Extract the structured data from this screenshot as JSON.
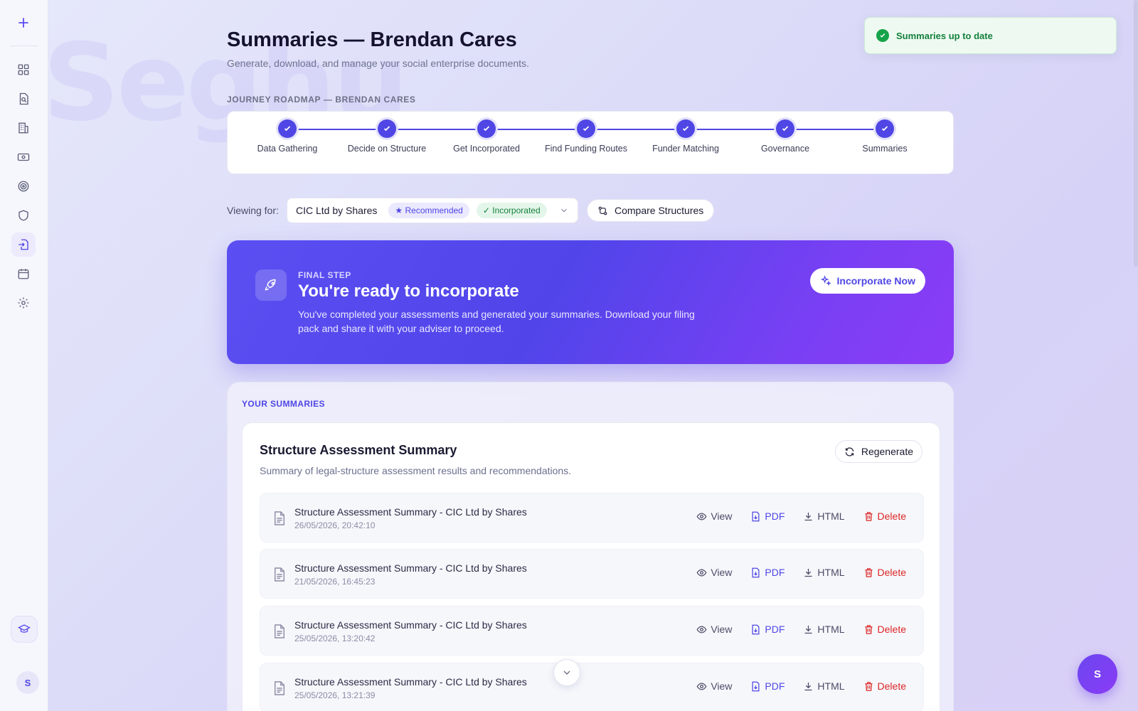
{
  "page": {
    "title": "Summaries — Brendan Cares",
    "subtitle": "Generate, download, and manage your social enterprise documents.",
    "watermark": "Seghu"
  },
  "sidebar": {
    "icons": [
      "plus-icon",
      "dashboard-icon",
      "search-document-icon",
      "building-icon",
      "money-icon",
      "target-icon",
      "shield-icon",
      "file-export-icon",
      "calendar-icon",
      "gear-icon",
      "graduation-cap-icon"
    ],
    "active": "file-export-icon",
    "avatar_initial": "S"
  },
  "roadmap": {
    "label": "JOURNEY ROADMAP — BRENDAN CARES",
    "steps": [
      {
        "label": "Data Gathering",
        "status": "complete"
      },
      {
        "label": "Decide on Structure",
        "status": "complete"
      },
      {
        "label": "Get Incorporated",
        "status": "complete"
      },
      {
        "label": "Find Funding Routes",
        "status": "complete"
      },
      {
        "label": "Funder Matching",
        "status": "complete"
      },
      {
        "label": "Governance",
        "status": "complete"
      },
      {
        "label": "Summaries",
        "status": "complete"
      }
    ]
  },
  "viewing": {
    "label": "Viewing for:",
    "structure": "CIC Ltd by Shares",
    "badge_recommended": "★ Recommended",
    "badge_incorporated": "✓ Incorporated",
    "compare_label": "Compare Structures"
  },
  "hero": {
    "eyebrow": "FINAL STEP",
    "title": "You're ready to incorporate",
    "text": "You've completed your assessments and generated your summaries. Download your filing pack and share it with your adviser to proceed.",
    "button": "Incorporate Now"
  },
  "summaries": {
    "label": "YOUR SUMMARIES",
    "card_title": "Structure Assessment Summary",
    "card_desc": "Summary of legal-structure assessment results and recommendations.",
    "regenerate": "Regenerate",
    "actions": {
      "view": "View",
      "pdf": "PDF",
      "html": "HTML",
      "delete": "Delete"
    },
    "documents": [
      {
        "name": "Structure Assessment Summary - CIC Ltd by Shares",
        "date": "26/05/2026, 20:42:10"
      },
      {
        "name": "Structure Assessment Summary - CIC Ltd by Shares",
        "date": "21/05/2026, 16:45:23"
      },
      {
        "name": "Structure Assessment Summary - CIC Ltd by Shares",
        "date": "25/05/2026, 13:20:42"
      },
      {
        "name": "Structure Assessment Summary - CIC Ltd by Shares",
        "date": "25/05/2026, 13:21:39"
      }
    ]
  },
  "toast": {
    "text": "Summaries up to date",
    "color": "#16a34a"
  },
  "fab": {
    "initial": "S"
  },
  "colors": {
    "accent": "#4f46e5",
    "danger": "#dc2626",
    "success": "#15803d"
  }
}
